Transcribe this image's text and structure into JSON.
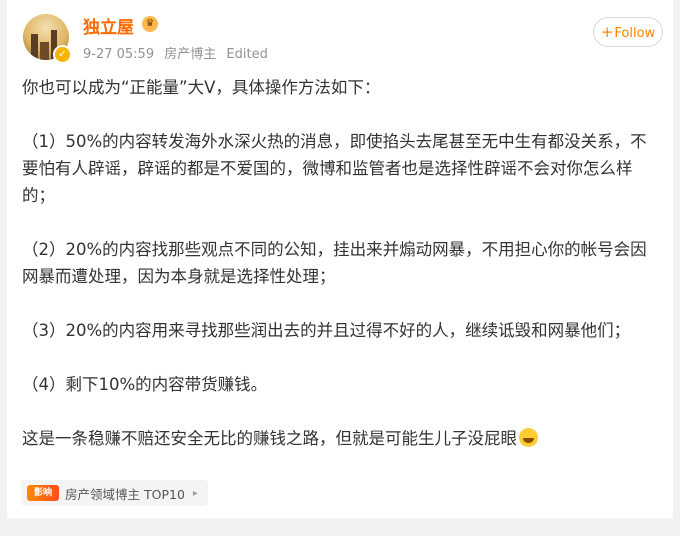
{
  "author": {
    "name": "独立屋",
    "avatar_icon": "avatar-image",
    "verified_icon": "verified-v-icon",
    "badge_icon": "member-crown-icon"
  },
  "meta": {
    "timestamp": "9-27 05:59",
    "source": "房产博主",
    "edited": "Edited"
  },
  "follow": {
    "plus": "+",
    "label": "Follow"
  },
  "post": {
    "lines": [
      "你也可以成为“正能量”大V，具体操作方法如下：",
      "（1）50%的内容转发海外水深火热的消息，即使掐头去尾甚至无中生有都没关系，不要怕有人辟谣，辟谣的都是不爱国的，微博和监管者也是选择性辟谣不会对你怎么样的；",
      "（2）20%的内容找那些观点不同的公知，挂出来并煽动网暴，不用担心你的帐号会因网暴而遭处理，因为本身就是选择性处理；",
      "（3）20%的内容用来寻找那些润出去的并且过得不好的人，继续诋毁和网暴他们；",
      "（4）剩下10%的内容带货赚钱。",
      "这是一条稳赚不赔还安全无比的赚钱之路，但就是可能生儿子没屁眼"
    ],
    "trailing_emoji": "grin-sweat-emoji"
  },
  "tag": {
    "icon_text": "影响",
    "label": "房产领域博主 TOP10",
    "chevron": "▸"
  }
}
